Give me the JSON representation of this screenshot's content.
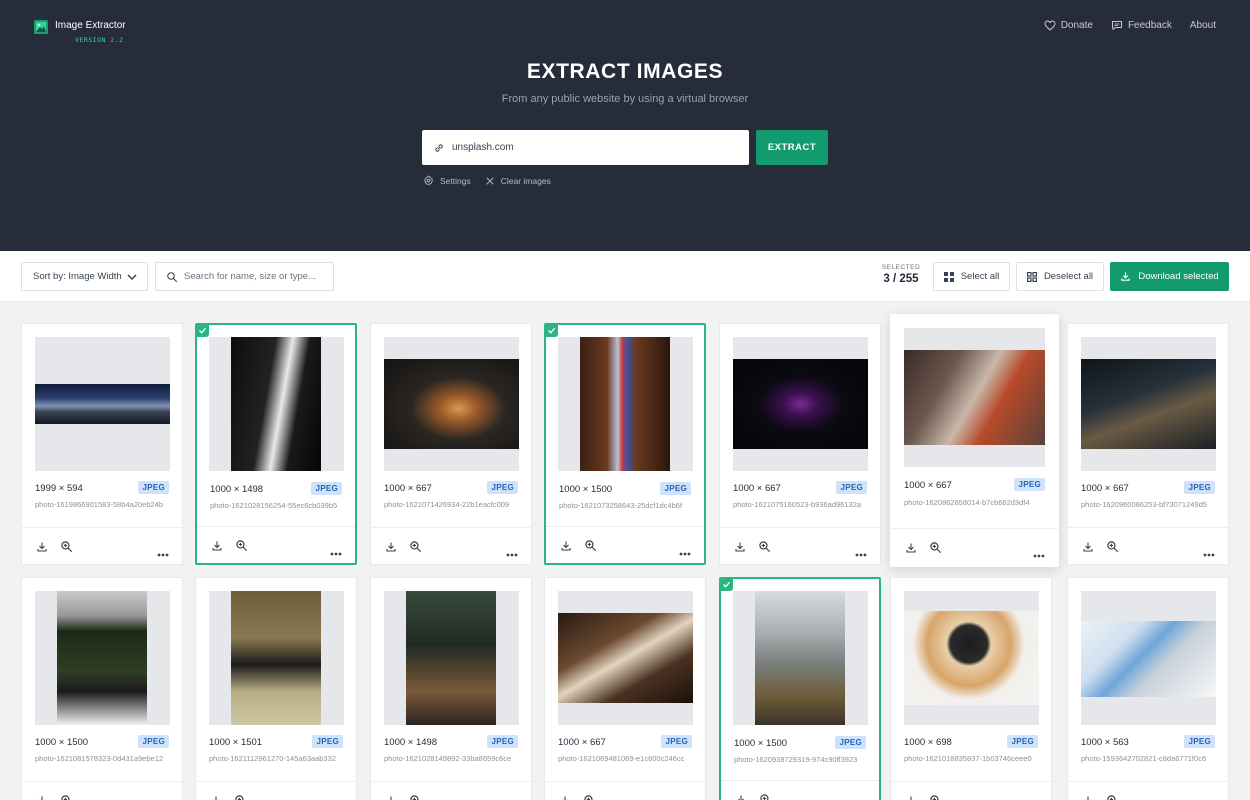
{
  "app": {
    "name": "Image Extractor",
    "version": "VERSION 2.2"
  },
  "nav": {
    "donate": "Donate",
    "feedback": "Feedback",
    "about": "About"
  },
  "hero": {
    "title": "EXTRACT IMAGES",
    "subtitle": "From any public website by using a virtual browser"
  },
  "form": {
    "url_value": "unsplash.com",
    "extract_label": "EXTRACT",
    "settings_label": "Settings",
    "clear_label": "Clear images"
  },
  "toolbar": {
    "sort_label": "Sort by: Image Width",
    "search_placeholder": "Search for name, size or type...",
    "selected_label": "SELECTED",
    "selected_count": "3 / 255",
    "select_all": "Select all",
    "deselect_all": "Deselect all",
    "download_selected": "Download selected"
  },
  "accent_color": "#139a6e",
  "images": [
    {
      "dims": "1999 × 594",
      "type": "JPEG",
      "name": "photo-1619866901583-58b4a20eb24b",
      "selected": false
    },
    {
      "dims": "1000 × 1498",
      "type": "JPEG",
      "name": "photo-1621028156254-55ec6cb039b5",
      "selected": true
    },
    {
      "dims": "1000 × 667",
      "type": "JPEG",
      "name": "photo-1621071426934-22b1eacfc009",
      "selected": false
    },
    {
      "dims": "1000 × 1500",
      "type": "JPEG",
      "name": "photo-1621073258643-25dcf1dc4b6f",
      "selected": true
    },
    {
      "dims": "1000 × 667",
      "type": "JPEG",
      "name": "photo-1621075160523-b936ad96132a",
      "selected": false
    },
    {
      "dims": "1000 × 667",
      "type": "JPEG",
      "name": "photo-1620862658014-b7cb662d3df4",
      "selected": false
    },
    {
      "dims": "1000 × 667",
      "type": "JPEG",
      "name": "photo-1620960086253-bf73071249d5",
      "selected": false
    },
    {
      "dims": "1000 × 1500",
      "type": "JPEG",
      "name": "photo-1621081578323-0d431a9ebe12",
      "selected": false
    },
    {
      "dims": "1000 × 1501",
      "type": "JPEG",
      "name": "photo-1621112961270-145a63aab332",
      "selected": false
    },
    {
      "dims": "1000 × 1498",
      "type": "JPEG",
      "name": "photo-1621028149892-33ba8659c6ce",
      "selected": false
    },
    {
      "dims": "1000 × 667",
      "type": "JPEG",
      "name": "photo-1621069481069-e1c600c246cc",
      "selected": false
    },
    {
      "dims": "1000 × 1500",
      "type": "JPEG",
      "name": "photo-1620938729319-974c90ff3923",
      "selected": true
    },
    {
      "dims": "1000 × 698",
      "type": "JPEG",
      "name": "photo-1621018835837-1b03746ceee0",
      "selected": false
    },
    {
      "dims": "1000 × 563",
      "type": "JPEG",
      "name": "photo-1593642702821-c8da6771f0c6",
      "selected": false
    }
  ]
}
